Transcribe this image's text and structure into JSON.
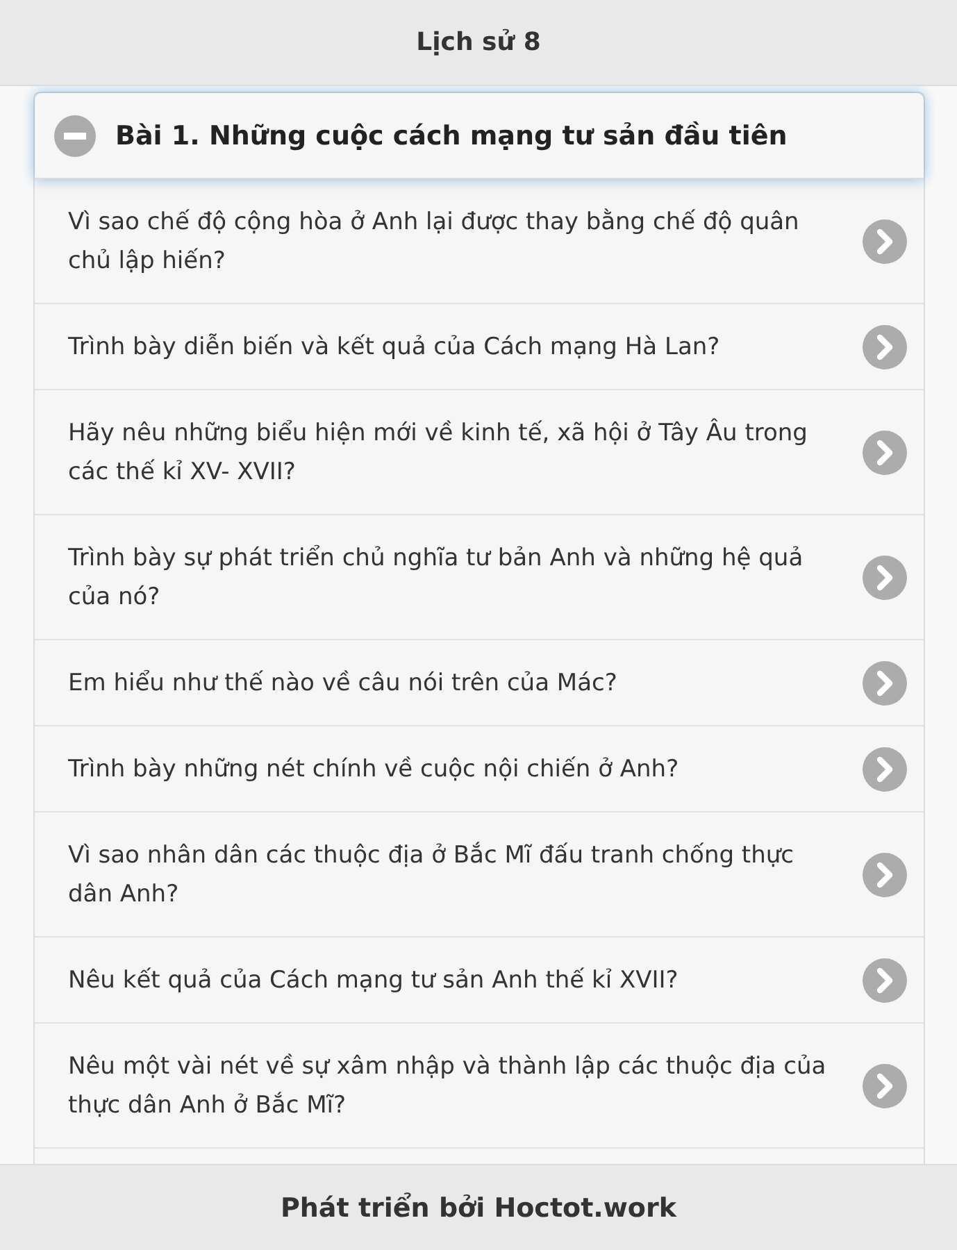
{
  "header": {
    "title": "Lịch sử 8"
  },
  "section": {
    "title": "Bài 1. Những cuộc cách mạng tư sản đầu tiên",
    "expanded": true,
    "questions": [
      "Vì sao chế độ cộng hòa ở Anh lại được thay bằng chế độ quân chủ lập hiến?",
      "Trình bày diễn biến và kết quả của Cách mạng Hà Lan?",
      "Hãy nêu những biểu hiện mới về kinh tế, xã hội ở Tây Âu trong các thế kỉ XV- XVII?",
      "Trình bày sự phát triển chủ nghĩa tư bản Anh và những hệ quả của nó?",
      "Em hiểu như thế nào về câu nói trên của Mác?",
      "Trình bày những nét chính về cuộc nội chiến ở Anh?",
      "Vì sao nhân dân các thuộc địa ở Bắc Mĩ đấu tranh chống thực dân Anh?",
      "Nêu kết quả của Cách mạng tư sản Anh thế kỉ XVII?",
      "Nêu một vài nét về sự xâm nhập và thành lập các thuộc địa của thực dân Anh ở Bắc Mĩ?"
    ]
  },
  "footer": {
    "text": "Phát triển bởi Hoctot.work"
  }
}
